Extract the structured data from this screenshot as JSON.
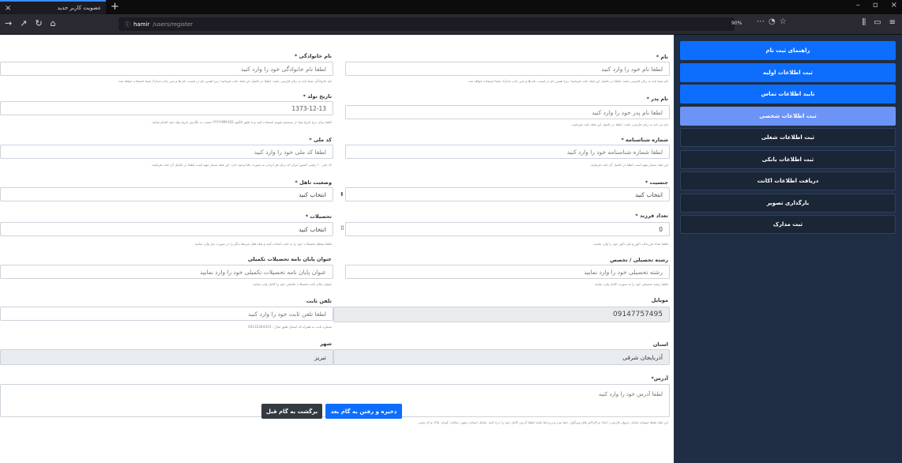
{
  "browser": {
    "tab_title": "عضویت کاربر جدید",
    "url_host": "hamir",
    "url_path": "/users/register",
    "zoom": "90%"
  },
  "sidebar": {
    "items": [
      {
        "label": "راهنمای ثبت نام",
        "state": "done"
      },
      {
        "label": "ثبت اطلاعات اولیه",
        "state": "done"
      },
      {
        "label": "تایید اطلاعات تماس",
        "state": "done"
      },
      {
        "label": "ثبت اطلاعات شخصی",
        "state": "active"
      },
      {
        "label": "ثبت اطلاعات شغلی",
        "state": "pending"
      },
      {
        "label": "ثبت اطلاعات بانکی",
        "state": "pending"
      },
      {
        "label": "دریافت اطلاعات اکانت",
        "state": "pending"
      },
      {
        "label": "بارگذاری تصویر",
        "state": "pending"
      },
      {
        "label": "ثبت مدارک",
        "state": "pending"
      }
    ]
  },
  "form": {
    "first_name": {
      "label": "نام *",
      "placeholder": "لطفا نام خود را وارد کنید",
      "help": "نام شما باید به زبان فارسی باشد. لطفا در تکمیل این فیلد دقت فرمایید؛ زیرا همین نام در لیست نام ها و متن چاپ مدارک شما استفاده خواهد شد."
    },
    "last_name": {
      "label": "نام خانوادگی *",
      "placeholder": "لطفا نام خانوادگی خود را وارد کنید",
      "help": "نام خانوادگی شما باید به زبان فارسی باشد. لطفا در تکمیل این فیلد دقت فرمایید؛ زیرا همین نام در لیست نام ها و متن چاپ مدارک شما استفاده خواهد شد."
    },
    "father_name": {
      "label": "نام پدر *",
      "placeholder": "لطفا نام پدر خود را وارد کنید",
      "help": "نام پدر باید به زبان فارسی باشد. لطفا در تکمیل این فیلد دقت فرمایید."
    },
    "birth_date": {
      "label": "تاریخ تولد *",
      "value": "1373-12-13",
      "help": "لطفا برای درج تاریخ تولد از سیستم تقویم استفاده کنید و یا طبق الگوی YYYY-MM-DD نسبت به نگارش تاریخ تولد خود اقدام نمایید."
    },
    "id_number": {
      "label": "شماره شناسنامه *",
      "placeholder": "لطفا شماره شناسنامه خود را وارد کنید",
      "help": "این فیلد بسیار مهم است لطفا در تکمیل آن دقت فرمایید."
    },
    "national_code": {
      "label": "کد ملی *",
      "placeholder": "لطفا کد ملی خود را وارد کنید",
      "help": "کد ملی ۱۰ رقمی کشور ایران که برای هر ایرانی به صورت یکتا وجود دارد. این فیلد بسیار مهم است لطفا در تکمیل آن دقت فرمایید."
    },
    "gender": {
      "label": "جنسیت *",
      "value": "انتخاب کنید"
    },
    "marital": {
      "label": "وضعیت تاهل *",
      "value": "انتخاب کنید"
    },
    "children": {
      "label": "تعداد فرزند *",
      "value": "0",
      "help": "لطفا تعداد فرزندان ذکور و غیر ذکور خود را وارد نمایید."
    },
    "education": {
      "label": "تحصیلات *",
      "value": "انتخاب کنید",
      "help": "لطفا سطح تحصیلات خود را به دقت انتخاب کنید و فیلد های مرتبط دیگر را در صورت نیاز وارد نمایید."
    },
    "major": {
      "label": "رشته تحصیلی / تخصص",
      "placeholder": "رشته تحصیلی خود را وارد نمایید",
      "help": "لطفا رشته تحصیلی خود را به صورت کامل وارد نمایید."
    },
    "thesis": {
      "label": "عنوان پایان نامه تحصیلات تکمیلی",
      "placeholder": "عنوان پایان نامه تحصیلات تکمیلی خود را وارد نمایید",
      "help": "عنوان پایان نامه تحصیلات تکمیلی خود را کامل وارد نمایید."
    },
    "mobile": {
      "label": "موبایل",
      "value": "09147757495"
    },
    "phone": {
      "label": "تلفن ثابت",
      "placeholder": "لطفا تلفن ثابت خود را وارد کنید",
      "help": "شماره ثابت به همراه کد استان طبق مثال : 04132344333"
    },
    "province": {
      "label": "استان",
      "value": "آذربایجان شرقی"
    },
    "city": {
      "label": "شهر",
      "value": "تبریز"
    },
    "address": {
      "label": "آدرس*",
      "placeholder": "لطفا آدرس خود را وارد کنید",
      "help": "این فیلد فقط میتواند شامل حروف فارسی، اعداد و کاراکتر های ویرگول، خط تیره و زیرخط باشد لطفا آدرس کامل خود را درج کنید. شامل استان، شهر، خیابان، کوچه، پلاک و کد پستی"
    },
    "next_button": "ذخیره و رفتن به گام بعد",
    "back_button": "برگشت به گام قبل"
  }
}
